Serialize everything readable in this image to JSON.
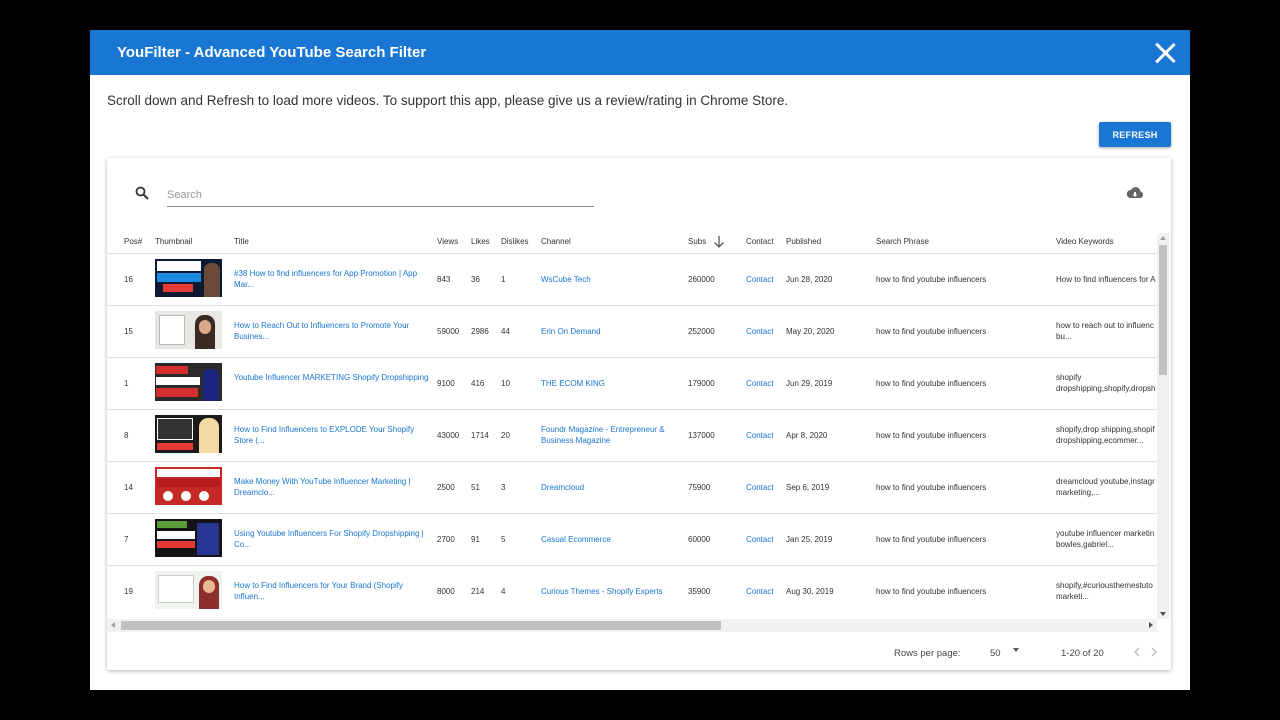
{
  "header": {
    "title": "YouFilter - Advanced YouTube Search Filter"
  },
  "notice": "Scroll down and Refresh to load more videos. To support this app, please give us a review/rating in Chrome Store.",
  "refresh_label": "REFRESH",
  "search": {
    "placeholder": "Search"
  },
  "columns": {
    "pos": "Pos#",
    "thumbnail": "Thumbnail",
    "title": "Title",
    "views": "Views",
    "likes": "Likes",
    "dislikes": "Dislikes",
    "channel": "Channel",
    "subs": "Subs",
    "contact": "Contact",
    "published": "Published",
    "search_phrase": "Search Phrase",
    "video_keywords": "Video Keywords"
  },
  "rows": [
    {
      "pos": "16",
      "title": "#38 How to find influencers for App Promotion | App Mar...",
      "views": "843",
      "likes": "36",
      "dislikes": "1",
      "channel": "WsCube Tech",
      "subs": "260000",
      "contact": "Contact",
      "published": "Jun 28, 2020",
      "phrase": "how to find youtube influencers",
      "keywords": "How to find influencers for A",
      "thumb_text": "HOW TO FIND INFLUENCERS FOR APP PROMOTION"
    },
    {
      "pos": "15",
      "title": "How to Reach Out to Influencers to Promote Your Busines...",
      "views": "59000",
      "likes": "2986",
      "dislikes": "44",
      "channel": "Erin On Demand",
      "subs": "252000",
      "contact": "Contact",
      "published": "May 20, 2020",
      "phrase": "how to find youtube influencers",
      "keywords": "how to reach out to influenc bu...",
      "thumb_text": ""
    },
    {
      "pos": "1",
      "title": "Youtube Influencer MARKETING Shopify Dropshipping",
      "views": "9100",
      "likes": "416",
      "dislikes": "10",
      "channel": "THE ECOM KING",
      "subs": "179000",
      "contact": "Contact",
      "published": "Jun 29, 2019",
      "phrase": "how to find youtube influencers",
      "keywords": "shopify dropshipping,shopify,dropsh",
      "thumb_text": "YOUTUBE INFLUENCER MARKETING"
    },
    {
      "pos": "8",
      "title": "How to Find Influencers to EXPLODE Your Shopify Store (...",
      "views": "43000",
      "likes": "1714",
      "dislikes": "20",
      "channel": "Foundr Magazine - Entrepreneur & Business Magazine",
      "subs": "137000",
      "contact": "Contact",
      "published": "Apr 8, 2020",
      "phrase": "how to find youtube influencers",
      "keywords": "shopify,drop shipping,shopif dropshipping,ecommer...",
      "thumb_text": "USING INFLUENCERS TO 10X YOUR SALES"
    },
    {
      "pos": "14",
      "title": "Make Money With YouTube Influencer Marketing | Dreamclo...",
      "views": "2500",
      "likes": "51",
      "dislikes": "3",
      "channel": "Dreamcloud",
      "subs": "75900",
      "contact": "Contact",
      "published": "Sep 6, 2019",
      "phrase": "how to find youtube influencers",
      "keywords": "dreamcloud youtube,instagr marketing,...",
      "thumb_text": "INFLUENCER MARKETING"
    },
    {
      "pos": "7",
      "title": "Using Youtube Influencers For Shopify Dropshipping | Co...",
      "views": "2700",
      "likes": "91",
      "dislikes": "5",
      "channel": "Casual Ecommerce",
      "subs": "60000",
      "contact": "Contact",
      "published": "Jan 25, 2019",
      "phrase": "how to find youtube influencers",
      "keywords": "youtube influencer marketin bowles,gabriel...",
      "thumb_text": "HOW TO USE YOUTUBE INFLUENCERS"
    },
    {
      "pos": "19",
      "title": "How to Find Influencers for Your Brand (Shopify Influen...",
      "views": "8000",
      "likes": "214",
      "dislikes": "4",
      "channel": "Curious Themes - Shopify Experts",
      "subs": "35900",
      "contact": "Contact",
      "published": "Aug 30, 2019",
      "phrase": "how to find youtube influencers",
      "keywords": "shopify,#curiousthemestuto marketi...",
      "thumb_text": "How to Find Influencers for Your Store"
    }
  ],
  "footer": {
    "rows_per_page_label": "Rows per page:",
    "rows_per_page_value": "50",
    "range": "1-20 of 20"
  },
  "colors": {
    "accent": "#1976d2",
    "link": "#1976d2"
  },
  "icons": {
    "close": "close-icon",
    "search": "search-icon",
    "download": "cloud-download-icon",
    "sort": "arrow-down-icon",
    "prev": "chevron-left-icon",
    "next": "chevron-right-icon"
  }
}
